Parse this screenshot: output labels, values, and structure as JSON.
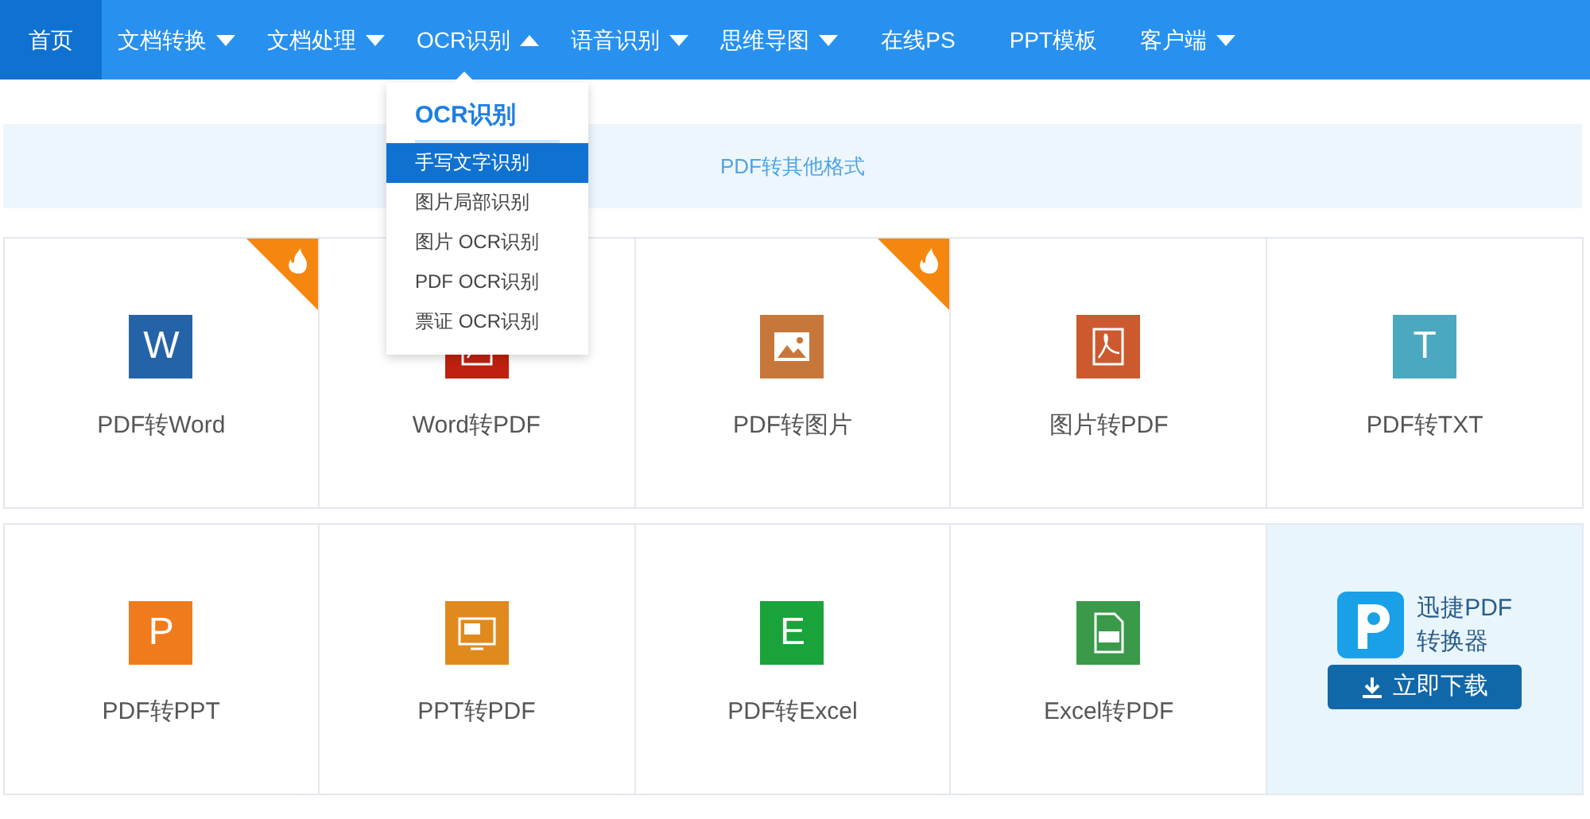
{
  "nav": [
    {
      "kind": "link",
      "label": "首页",
      "selected": true
    },
    {
      "kind": "menu",
      "label": "文档转换",
      "selected": false,
      "expanded": false
    },
    {
      "kind": "menu",
      "label": "文档处理",
      "selected": false,
      "expanded": false
    },
    {
      "kind": "menu",
      "label": "OCR识别",
      "selected": false,
      "expanded": true
    },
    {
      "kind": "menu",
      "label": "语音识别",
      "selected": false,
      "expanded": false
    },
    {
      "kind": "menu",
      "label": "思维导图",
      "selected": false,
      "expanded": false
    },
    {
      "kind": "link",
      "label": "在线PS",
      "selected": false
    },
    {
      "kind": "link",
      "label": "PPT模板",
      "selected": false
    },
    {
      "kind": "menu",
      "label": "客户端",
      "selected": false,
      "expanded": false
    }
  ],
  "dropdown": {
    "title": "OCR识别",
    "items": [
      {
        "label": "手写文字识别",
        "selected": true
      },
      {
        "label": "图片局部识别",
        "selected": false
      },
      {
        "label": "图片 OCR识别",
        "selected": false
      },
      {
        "label": "PDF OCR识别",
        "selected": false
      },
      {
        "label": "票证 OCR识别",
        "selected": false
      }
    ]
  },
  "banner": {
    "label": "PDF转其他格式"
  },
  "tiles": [
    {
      "kind": "glyph",
      "label": "PDF转Word",
      "glyph": "W",
      "color": "#2563a8",
      "hot": true
    },
    {
      "kind": "pdf",
      "label": "Word转PDF",
      "color": "#c0200f",
      "hot": false
    },
    {
      "kind": "image",
      "label": "PDF转图片",
      "color": "#c8773a",
      "hot": true
    },
    {
      "kind": "pdf",
      "label": "图片转PDF",
      "color": "#cc5a2e",
      "hot": false
    },
    {
      "kind": "glyph",
      "label": "PDF转TXT",
      "glyph": "T",
      "color": "#4aa8c0",
      "hot": false
    },
    {
      "kind": "glyph",
      "label": "PDF转PPT",
      "glyph": "P",
      "color": "#f07b1c",
      "hot": false
    },
    {
      "kind": "slide",
      "label": "PPT转PDF",
      "color": "#e08a1e",
      "hot": false
    },
    {
      "kind": "glyph",
      "label": "PDF转Excel",
      "glyph": "E",
      "color": "#1aa33a",
      "hot": false
    },
    {
      "kind": "sheet",
      "label": "Excel转PDF",
      "color": "#3a9a4a",
      "hot": false
    },
    {
      "kind": "promo",
      "name_lines": [
        "迅捷PDF",
        "转换器"
      ],
      "button": "立即下载"
    }
  ]
}
